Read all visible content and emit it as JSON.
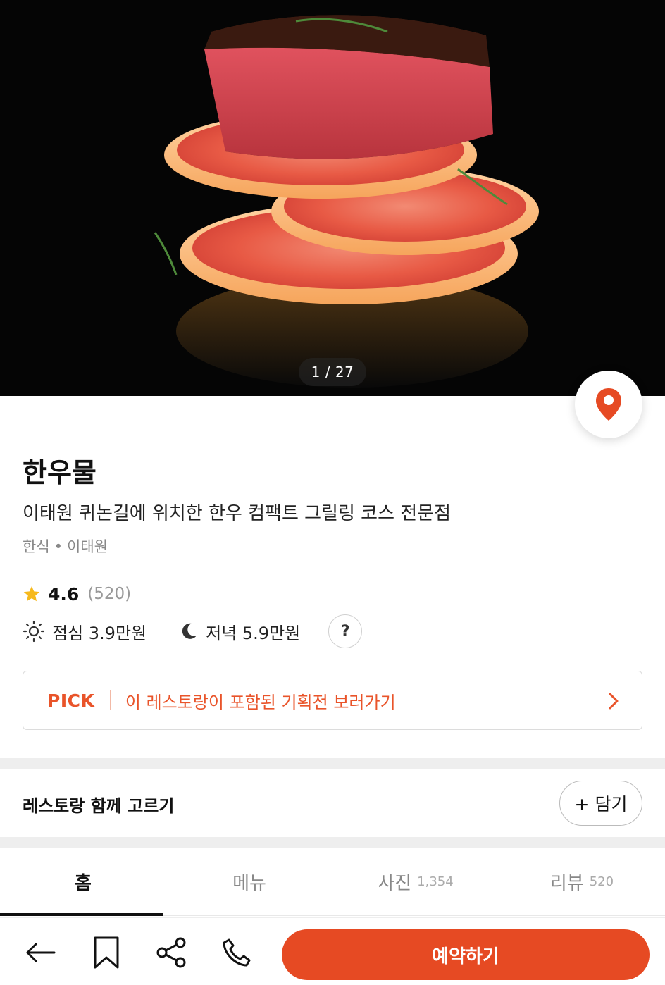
{
  "hero": {
    "photo_counter": "1 / 27",
    "photo_subject": "steak on grapefruit slices"
  },
  "restaurant": {
    "name": "한우물",
    "tagline": "이태원 퀴논길에 위치한 한우 컴팩트 그릴링 코스 전문점",
    "category": "한식",
    "separator": "•",
    "area": "이태원",
    "rating": "4.6",
    "review_count": "(520)",
    "lunch_price": "점심 3.9만원",
    "dinner_price": "저녁 5.9만원",
    "help": "?"
  },
  "pick": {
    "tag": "PICK",
    "text": "이 레스토랑이 포함된 기획전 보러가기"
  },
  "together": {
    "label": "레스토랑 함께 고르기",
    "add_label": "+ 담기"
  },
  "tabs": [
    {
      "label": "홈",
      "count": ""
    },
    {
      "label": "메뉴",
      "count": ""
    },
    {
      "label": "사진",
      "count": "1,354"
    },
    {
      "label": "리뷰",
      "count": "520"
    }
  ],
  "bottom": {
    "reserve_label": "예약하기"
  },
  "icons": {
    "location": "map-pin-icon",
    "star": "star-icon",
    "lunch": "sun-icon",
    "dinner": "moon-icon",
    "chevron": "chevron-right-icon",
    "back": "back-arrow-icon",
    "bookmark": "bookmark-icon",
    "share": "share-icon",
    "call": "phone-icon"
  },
  "colors": {
    "accent": "#e64a23",
    "star": "#f6b91d"
  }
}
